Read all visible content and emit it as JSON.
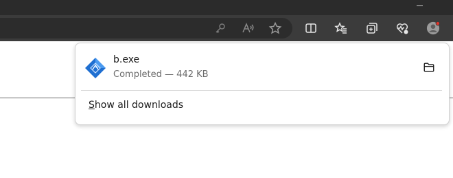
{
  "colors": {
    "title_bar": "#2b2b2b",
    "toolbar": "#3b3b3b",
    "address_bar": "#2c2c2c",
    "notification_dot": "#e0352b",
    "file_icon": "#1f6fd1"
  },
  "toolbar": {
    "icons": [
      "key-icon",
      "read-aloud-icon",
      "favorite-star-icon",
      "split-screen-icon",
      "favorites-icon",
      "collections-icon",
      "browser-essentials-icon",
      "profile-icon"
    ]
  },
  "downloads": {
    "items": [
      {
        "name": "b.exe",
        "status": "Completed — 442 KB",
        "icon": "exe-file-icon"
      }
    ],
    "show_all_mnemonic": "S",
    "show_all_rest": "how all downloads"
  }
}
